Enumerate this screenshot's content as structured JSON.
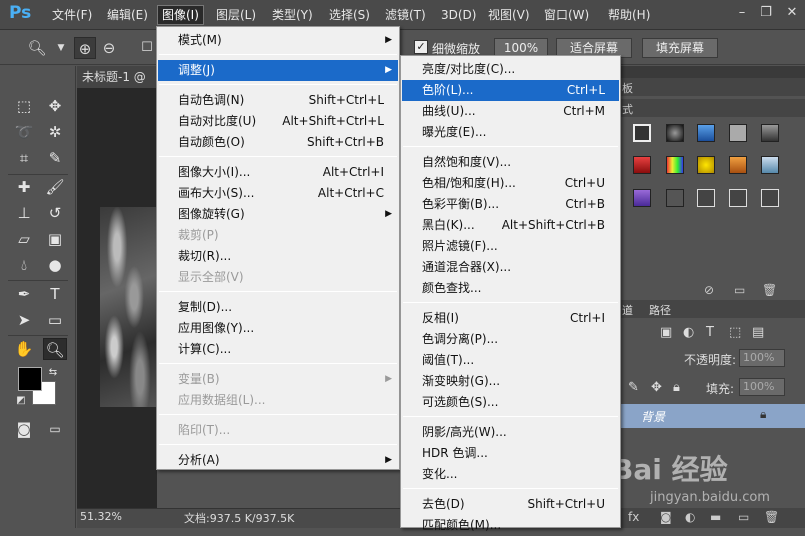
{
  "app": {
    "logo": "Ps",
    "menubar": [
      "文件(F)",
      "编辑(E)",
      "图像(I)",
      "图层(L)",
      "类型(Y)",
      "选择(S)",
      "滤镜(T)",
      "3D(D)",
      "视图(V)",
      "窗口(W)",
      "帮助(H)"
    ],
    "active_menu": "图像(I)"
  },
  "options_bar": {
    "scrubby_zoom_label": "细微缩放",
    "zoom_value": "100%",
    "fit_screen": "适合屏幕",
    "fill_screen": "填充屏幕"
  },
  "document": {
    "tab_title": "未标题-1 @",
    "zoom": "51.32%",
    "doc_info": "文档:937.5 K/937.5K"
  },
  "image_menu": [
    {
      "label": "模式(M)",
      "submenu": true
    },
    {
      "sep": true
    },
    {
      "label": "调整(J)",
      "submenu": true,
      "highlight": true
    },
    {
      "sep": true
    },
    {
      "label": "自动色调(N)",
      "shortcut": "Shift+Ctrl+L"
    },
    {
      "label": "自动对比度(U)",
      "shortcut": "Alt+Shift+Ctrl+L"
    },
    {
      "label": "自动颜色(O)",
      "shortcut": "Shift+Ctrl+B"
    },
    {
      "sep": true
    },
    {
      "label": "图像大小(I)...",
      "shortcut": "Alt+Ctrl+I"
    },
    {
      "label": "画布大小(S)...",
      "shortcut": "Alt+Ctrl+C"
    },
    {
      "label": "图像旋转(G)",
      "submenu": true
    },
    {
      "label": "裁剪(P)",
      "disabled": true
    },
    {
      "label": "裁切(R)..."
    },
    {
      "label": "显示全部(V)",
      "disabled": true
    },
    {
      "sep": true
    },
    {
      "label": "复制(D)..."
    },
    {
      "label": "应用图像(Y)..."
    },
    {
      "label": "计算(C)..."
    },
    {
      "sep": true
    },
    {
      "label": "变量(B)",
      "submenu": true,
      "disabled": true
    },
    {
      "label": "应用数据组(L)...",
      "disabled": true
    },
    {
      "sep": true
    },
    {
      "label": "陷印(T)...",
      "disabled": true
    },
    {
      "sep": true
    },
    {
      "label": "分析(A)",
      "submenu": true
    }
  ],
  "adjust_submenu": [
    {
      "label": "亮度/对比度(C)..."
    },
    {
      "label": "色阶(L)...",
      "shortcut": "Ctrl+L",
      "highlight": true
    },
    {
      "label": "曲线(U)...",
      "shortcut": "Ctrl+M"
    },
    {
      "label": "曝光度(E)..."
    },
    {
      "sep": true
    },
    {
      "label": "自然饱和度(V)..."
    },
    {
      "label": "色相/饱和度(H)...",
      "shortcut": "Ctrl+U"
    },
    {
      "label": "色彩平衡(B)...",
      "shortcut": "Ctrl+B"
    },
    {
      "label": "黑白(K)...",
      "shortcut": "Alt+Shift+Ctrl+B"
    },
    {
      "label": "照片滤镜(F)..."
    },
    {
      "label": "通道混合器(X)..."
    },
    {
      "label": "颜色查找..."
    },
    {
      "sep": true
    },
    {
      "label": "反相(I)",
      "shortcut": "Ctrl+I"
    },
    {
      "label": "色调分离(P)..."
    },
    {
      "label": "阈值(T)..."
    },
    {
      "label": "渐变映射(G)..."
    },
    {
      "label": "可选颜色(S)..."
    },
    {
      "sep": true
    },
    {
      "label": "阴影/高光(W)..."
    },
    {
      "label": "HDR 色调..."
    },
    {
      "label": "变化..."
    },
    {
      "sep": true
    },
    {
      "label": "去色(D)",
      "shortcut": "Shift+Ctrl+U"
    },
    {
      "label": "匹配颜色(M)..."
    }
  ],
  "panels": {
    "adjust_tab_fragment": "板",
    "styles_tab_fragment": "式",
    "layers_tab_fragment": "道",
    "paths_tab": "路径",
    "opacity_label": "不透明度:",
    "opacity_value": "100%",
    "fill_label": "填充:",
    "fill_value": "100%",
    "layer_name": "背景"
  },
  "watermark": {
    "text": "Bai 经验",
    "url": "jingyan.baidu.com"
  }
}
